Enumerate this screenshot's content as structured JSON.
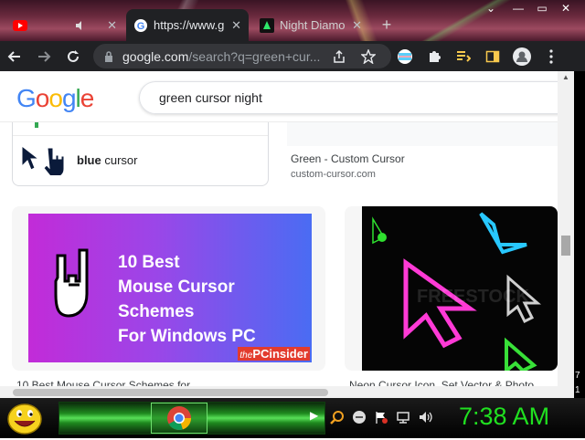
{
  "browser": {
    "tabs": [
      {
        "title": "",
        "favicon": "youtube-icon",
        "active": false
      },
      {
        "title": "https://www.g",
        "favicon": "google-g-icon",
        "active": true
      },
      {
        "title": "Night Diamo",
        "favicon": "night-diamond-icon",
        "active": false
      }
    ],
    "close_glyph": "✕",
    "window_controls": [
      "—",
      "▭",
      "✕"
    ]
  },
  "toolbar": {
    "url_host": "google.com",
    "url_path": "/search?q=green+cur..."
  },
  "search": {
    "logo": [
      "G",
      "o",
      "o",
      "g",
      "l",
      "e"
    ],
    "logo_colors": [
      "#4285F4",
      "#EA4335",
      "#FBBC05",
      "#4285F4",
      "#34A853",
      "#EA4335"
    ],
    "query": "green cursor night"
  },
  "related": {
    "bold": "blue",
    "rest": " cursor"
  },
  "results": [
    {
      "title": "Green - Custom Cursor",
      "source": "custom-cursor.com"
    },
    {
      "title": "10 Best Mouse Cursor Schemes for ...",
      "source": "",
      "image_lines": [
        "10 Best",
        "Mouse Cursor Schemes",
        "For Windows PC"
      ],
      "brand_the": "the",
      "brand": "PCinsider"
    },
    {
      "title": "Neon Cursor Icon, Set Vector & Photo ...",
      "source": "",
      "watermark": "FREESTOCK"
    }
  ],
  "taskbar": {
    "clock": "7:38 AM",
    "side_digits": [
      "7",
      "1"
    ],
    "tray_icons": [
      "search-icon",
      "minus-circle-icon",
      "flag-icon",
      "network-icon",
      "volume-icon"
    ]
  },
  "colors": {
    "accent_green": "#20e020",
    "chrome_dark": "#202124"
  }
}
